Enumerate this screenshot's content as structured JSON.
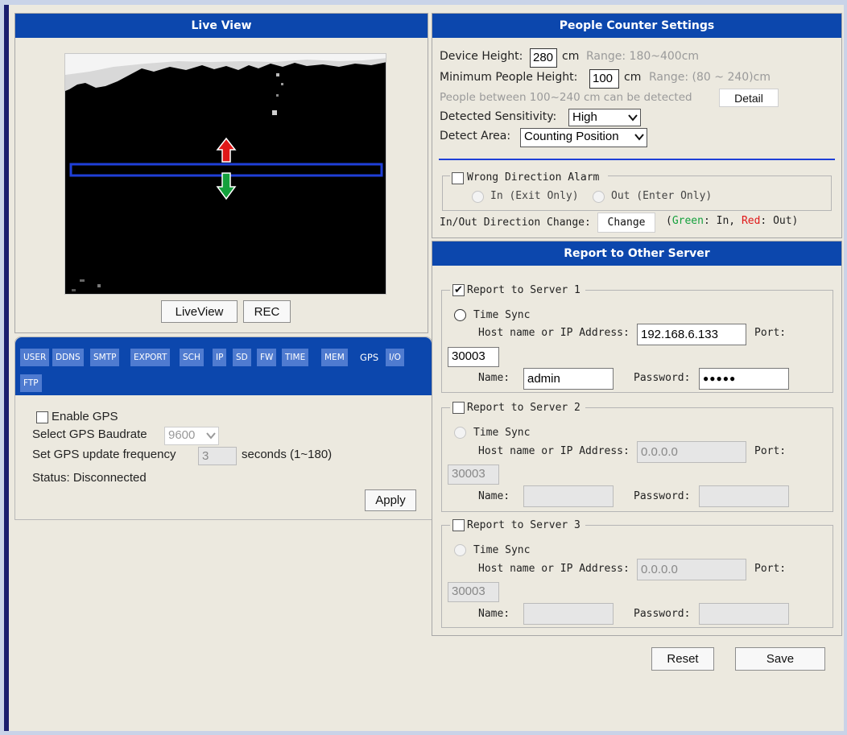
{
  "live_view": {
    "title": "Live View",
    "liveview_btn": "LiveView",
    "rec_btn": "REC"
  },
  "people_counter": {
    "title": "People Counter Settings",
    "device_height_label": "Device Height:",
    "device_height_value": "280",
    "device_height_unit": "cm",
    "device_height_range": "Range: 180~400cm",
    "min_height_label": "Minimum People Height:",
    "min_height_value": "100",
    "min_height_unit": "cm",
    "min_height_range": "Range: (80 ~ 240)cm",
    "detect_note": "People between 100~240 cm can be detected",
    "detail_btn": "Detail",
    "sensitivity_label": "Detected Sensitivity:",
    "sensitivity_value": "High",
    "area_label": "Detect Area:",
    "area_value": "Counting Position",
    "wrong_dir_label": "Wrong Direction Alarm",
    "wrong_dir_checked": false,
    "in_label": "In (Exit Only)",
    "out_label": "Out (Enter Only)",
    "dir_change_label": "In/Out Direction Change:",
    "change_btn": "Change",
    "legend_open": "(",
    "legend_green": "Green",
    "legend_in": ": In, ",
    "legend_red": "Red",
    "legend_out": ": Out)"
  },
  "tabs": [
    "USER",
    "DDNS",
    "SMTP",
    "EXPORT",
    "SCH",
    "IP",
    "SD",
    "FW",
    "TIME",
    "MEM",
    "GPS",
    "I/O",
    "FTP"
  ],
  "active_tab": "GPS",
  "gps": {
    "enable_label": "Enable GPS",
    "enabled": false,
    "baudrate_label": "Select GPS Baudrate",
    "baudrate_value": "9600",
    "freq_label": "Set GPS update frequency",
    "freq_value": "3",
    "freq_unit": "seconds (1~180)",
    "status": "Status: Disconnected",
    "apply_btn": "Apply"
  },
  "report": {
    "title": "Report to Other Server",
    "time_sync": "Time Sync",
    "host_label": "Host name or IP Address:",
    "port_label": "Port:",
    "name_label": "Name:",
    "password_label": "Password:",
    "servers": [
      {
        "label": "Report to Server 1",
        "checked": true,
        "host": "192.168.6.133",
        "port": "30003",
        "name": "admin",
        "password": "●●●●●"
      },
      {
        "label": "Report to Server 2",
        "checked": false,
        "host": "0.0.0.0",
        "port": "30003",
        "name": "",
        "password": ""
      },
      {
        "label": "Report to Server 3",
        "checked": false,
        "host": "0.0.0.0",
        "port": "30003",
        "name": "",
        "password": ""
      }
    ]
  },
  "footer": {
    "reset_btn": "Reset",
    "save_btn": "Save"
  },
  "colors": {
    "header_blue": "#0c47ad",
    "tab_blue": "#4f7bd0",
    "line_blue": "#1f3fd8",
    "arrow_red": "#e01818",
    "arrow_green": "#14a03c"
  }
}
